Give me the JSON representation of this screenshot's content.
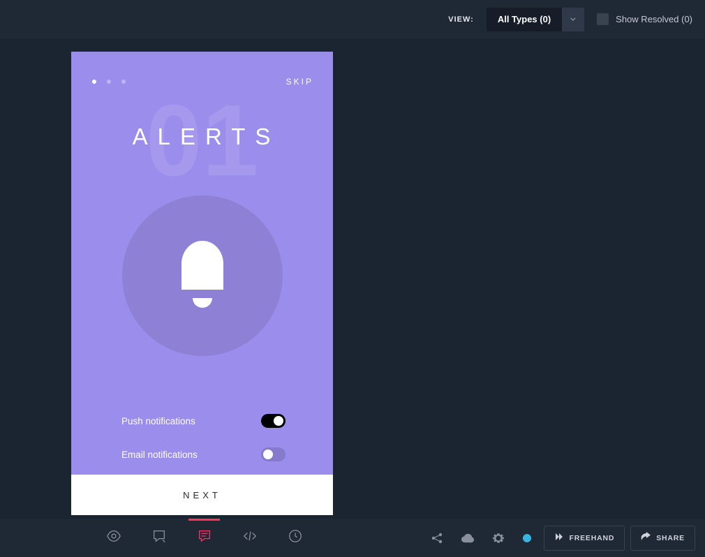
{
  "topbar": {
    "view_label": "VIEW:",
    "type_filter": "All Types (0)",
    "show_resolved_label": "Show Resolved (0)"
  },
  "mock": {
    "skip_label": "SKIP",
    "bg_number": "01",
    "title": "ALERTS",
    "settings": [
      {
        "label": "Push notifications",
        "on": true
      },
      {
        "label": "Email notifications",
        "on": false
      }
    ],
    "next_label": "NEXT"
  },
  "bottombar": {
    "freehand_label": "FREEHAND",
    "share_label": "SHARE"
  }
}
